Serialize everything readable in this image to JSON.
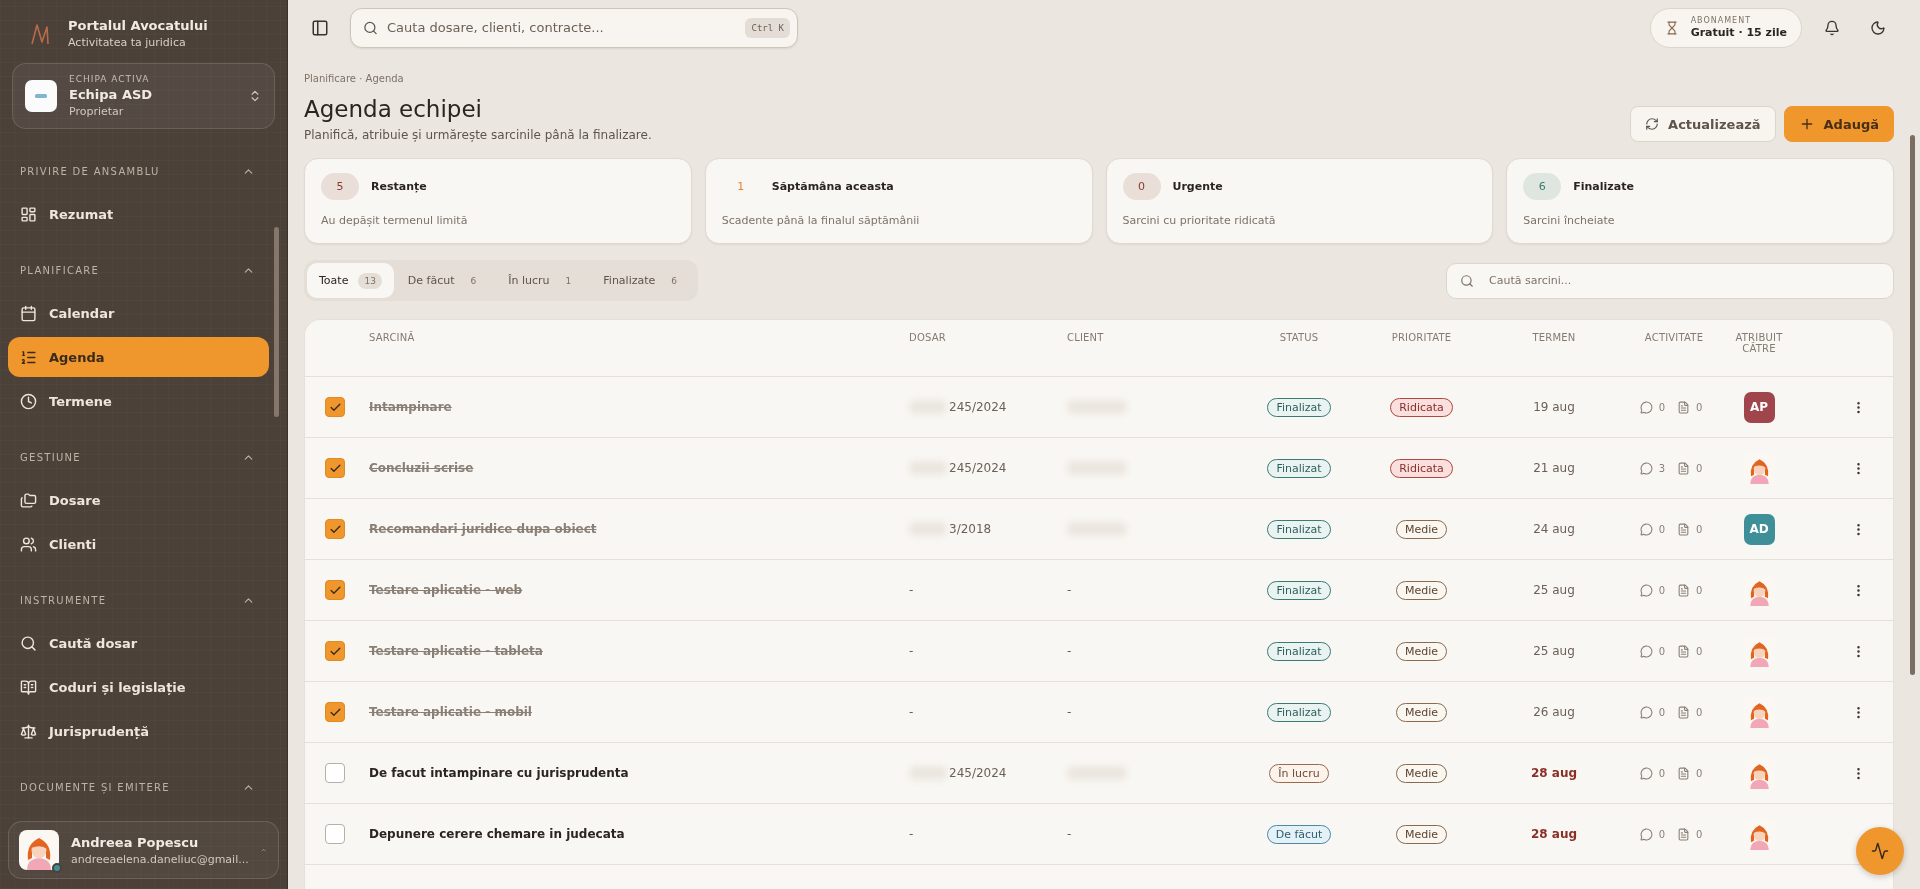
{
  "app": {
    "title": "Portalul Avocatului",
    "subtitle": "Activitatea ta juridica"
  },
  "team": {
    "label": "ECHIPA ACTIVA",
    "name": "Echipa ASD",
    "role": "Proprietar"
  },
  "sidebar": {
    "sections": [
      {
        "title": "PRIVIRE DE ANSAMBLU",
        "expanded": true,
        "items": [
          {
            "label": "Rezumat",
            "selected": false
          }
        ]
      },
      {
        "title": "PLANIFICARE",
        "expanded": true,
        "items": [
          {
            "label": "Calendar",
            "selected": false
          },
          {
            "label": "Agenda",
            "selected": true
          },
          {
            "label": "Termene",
            "selected": false
          }
        ]
      },
      {
        "title": "GESTIUNE",
        "expanded": true,
        "items": [
          {
            "label": "Dosare",
            "selected": false
          },
          {
            "label": "Clienti",
            "selected": false
          }
        ]
      },
      {
        "title": "INSTRUMENTE",
        "expanded": true,
        "items": [
          {
            "label": "Caută dosar",
            "selected": false
          },
          {
            "label": "Coduri și legislație",
            "selected": false
          },
          {
            "label": "Jurisprudență",
            "selected": false
          }
        ]
      },
      {
        "title": "DOCUMENTE ȘI EMITERE",
        "expanded": true
      }
    ]
  },
  "user": {
    "name": "Andreea Popescu",
    "email": "andreeaelena.daneliuc@gmail...",
    "online": true
  },
  "topbar": {
    "search_placeholder": "Cauta dosare, clienti, contracte...",
    "shortcut": "Ctrl K",
    "subscription": {
      "label": "ABONAMENT",
      "plan": "Gratuit · 15 zile"
    }
  },
  "page": {
    "breadcrumb": "Planificare · Agenda",
    "title": "Agenda echipei",
    "subtitle": "Planifică, atribuie și urmărește sarcinile până la finalizare.",
    "buttons": [
      {
        "label": "Actualizează",
        "kind": "refresh"
      },
      {
        "label": "Adaugă",
        "kind": "add"
      }
    ]
  },
  "stats": [
    {
      "count": "5",
      "title": "Restanțe",
      "subtitle": "Au depășit termenul limită",
      "color": "#8a3a30",
      "tinted": true
    },
    {
      "count": "1",
      "title": "Săptămâna aceasta",
      "subtitle": "Scadente până la finalul săptămânii",
      "color": "#e8862a",
      "tinted": false
    },
    {
      "count": "0",
      "title": "Urgente",
      "subtitle": "Sarcini cu prioritate ridicată",
      "color": "#8a3a30",
      "tinted": true
    },
    {
      "count": "6",
      "title": "Finalizate",
      "subtitle": "Sarcini încheiate",
      "color": "#3c7a6c",
      "tinted": true
    }
  ],
  "tabs": [
    {
      "label": "Toate",
      "count": "13",
      "selected": true
    },
    {
      "label": "De făcut",
      "count": "6",
      "selected": false
    },
    {
      "label": "În lucru",
      "count": "1",
      "selected": false
    },
    {
      "label": "Finalizate",
      "count": "6",
      "selected": false
    }
  ],
  "task_search": {
    "placeholder": "Caută sarcini..."
  },
  "table": {
    "columns": [
      "SARCINĂ",
      "DOSAR",
      "CLIENT",
      "STATUS",
      "PRIORITATE",
      "TERMEN",
      "ACTIVITATE",
      "ATRIBUIT CĂTRE"
    ],
    "rows": [
      {
        "checked": true,
        "task": "Intampinare",
        "dosar": {
          "number": "245/2024",
          "redacted": true
        },
        "client": {
          "redacted": true
        },
        "status": {
          "label": "Finalizat",
          "kind": "done"
        },
        "priority": {
          "label": "Ridicata",
          "kind": "high"
        },
        "due": "19 aug",
        "overdue": false,
        "comments": "0",
        "files": "0",
        "has_menu": true,
        "assignee": {
          "kind": "initials",
          "text": "AP",
          "color": "#a0454c"
        }
      },
      {
        "checked": true,
        "task": "Concluzii scrise",
        "dosar": {
          "number": "245/2024",
          "redacted": true
        },
        "client": {
          "redacted": true
        },
        "status": {
          "label": "Finalizat",
          "kind": "done"
        },
        "priority": {
          "label": "Ridicata",
          "kind": "high"
        },
        "due": "21 aug",
        "overdue": false,
        "comments": "3",
        "files": "0",
        "has_menu": true,
        "assignee": {
          "kind": "avatar"
        }
      },
      {
        "checked": true,
        "task": "Recomandari juridice dupa obiect",
        "dosar": {
          "number": "3/2018",
          "redacted": true
        },
        "client": {
          "redacted": true
        },
        "status": {
          "label": "Finalizat",
          "kind": "done"
        },
        "priority": {
          "label": "Medie",
          "kind": "medium"
        },
        "due": "24 aug",
        "overdue": false,
        "comments": "0",
        "files": "0",
        "has_menu": true,
        "assignee": {
          "kind": "initials",
          "text": "AD",
          "color": "#3f8f98"
        }
      },
      {
        "checked": true,
        "task": "Testare aplicatie - web",
        "dosar": {
          "number": "-"
        },
        "client": {
          "text": "-"
        },
        "status": {
          "label": "Finalizat",
          "kind": "done"
        },
        "priority": {
          "label": "Medie",
          "kind": "medium"
        },
        "due": "25 aug",
        "overdue": false,
        "comments": "0",
        "files": "0",
        "has_menu": true,
        "assignee": {
          "kind": "avatar"
        }
      },
      {
        "checked": true,
        "task": "Testare aplicatie - tableta",
        "dosar": {
          "number": "-"
        },
        "client": {
          "text": "-"
        },
        "status": {
          "label": "Finalizat",
          "kind": "done"
        },
        "priority": {
          "label": "Medie",
          "kind": "medium"
        },
        "due": "25 aug",
        "overdue": false,
        "comments": "0",
        "files": "0",
        "has_menu": true,
        "assignee": {
          "kind": "avatar"
        }
      },
      {
        "checked": true,
        "task": "Testare aplicatie - mobil",
        "dosar": {
          "number": "-"
        },
        "client": {
          "text": "-"
        },
        "status": {
          "label": "Finalizat",
          "kind": "done"
        },
        "priority": {
          "label": "Medie",
          "kind": "medium"
        },
        "due": "26 aug",
        "overdue": false,
        "comments": "0",
        "files": "0",
        "has_menu": true,
        "assignee": {
          "kind": "avatar"
        }
      },
      {
        "checked": false,
        "task": "De facut intampinare cu jurisprudenta",
        "dosar": {
          "number": "245/2024",
          "redacted": true
        },
        "client": {
          "redacted": true
        },
        "status": {
          "label": "În lucru",
          "kind": "progress"
        },
        "priority": {
          "label": "Medie",
          "kind": "medium"
        },
        "due": "28 aug",
        "overdue": true,
        "comments": "0",
        "files": "0",
        "has_menu": true,
        "assignee": {
          "kind": "avatar"
        }
      },
      {
        "checked": false,
        "task": "Depunere cerere chemare in judecata",
        "dosar": {
          "number": "-"
        },
        "client": {
          "text": "-"
        },
        "status": {
          "label": "De făcut",
          "kind": "todo"
        },
        "priority": {
          "label": "Medie",
          "kind": "medium"
        },
        "due": "28 aug",
        "overdue": true,
        "comments": "0",
        "files": "0",
        "has_menu": false,
        "assignee": {
          "kind": "avatar"
        }
      }
    ]
  }
}
